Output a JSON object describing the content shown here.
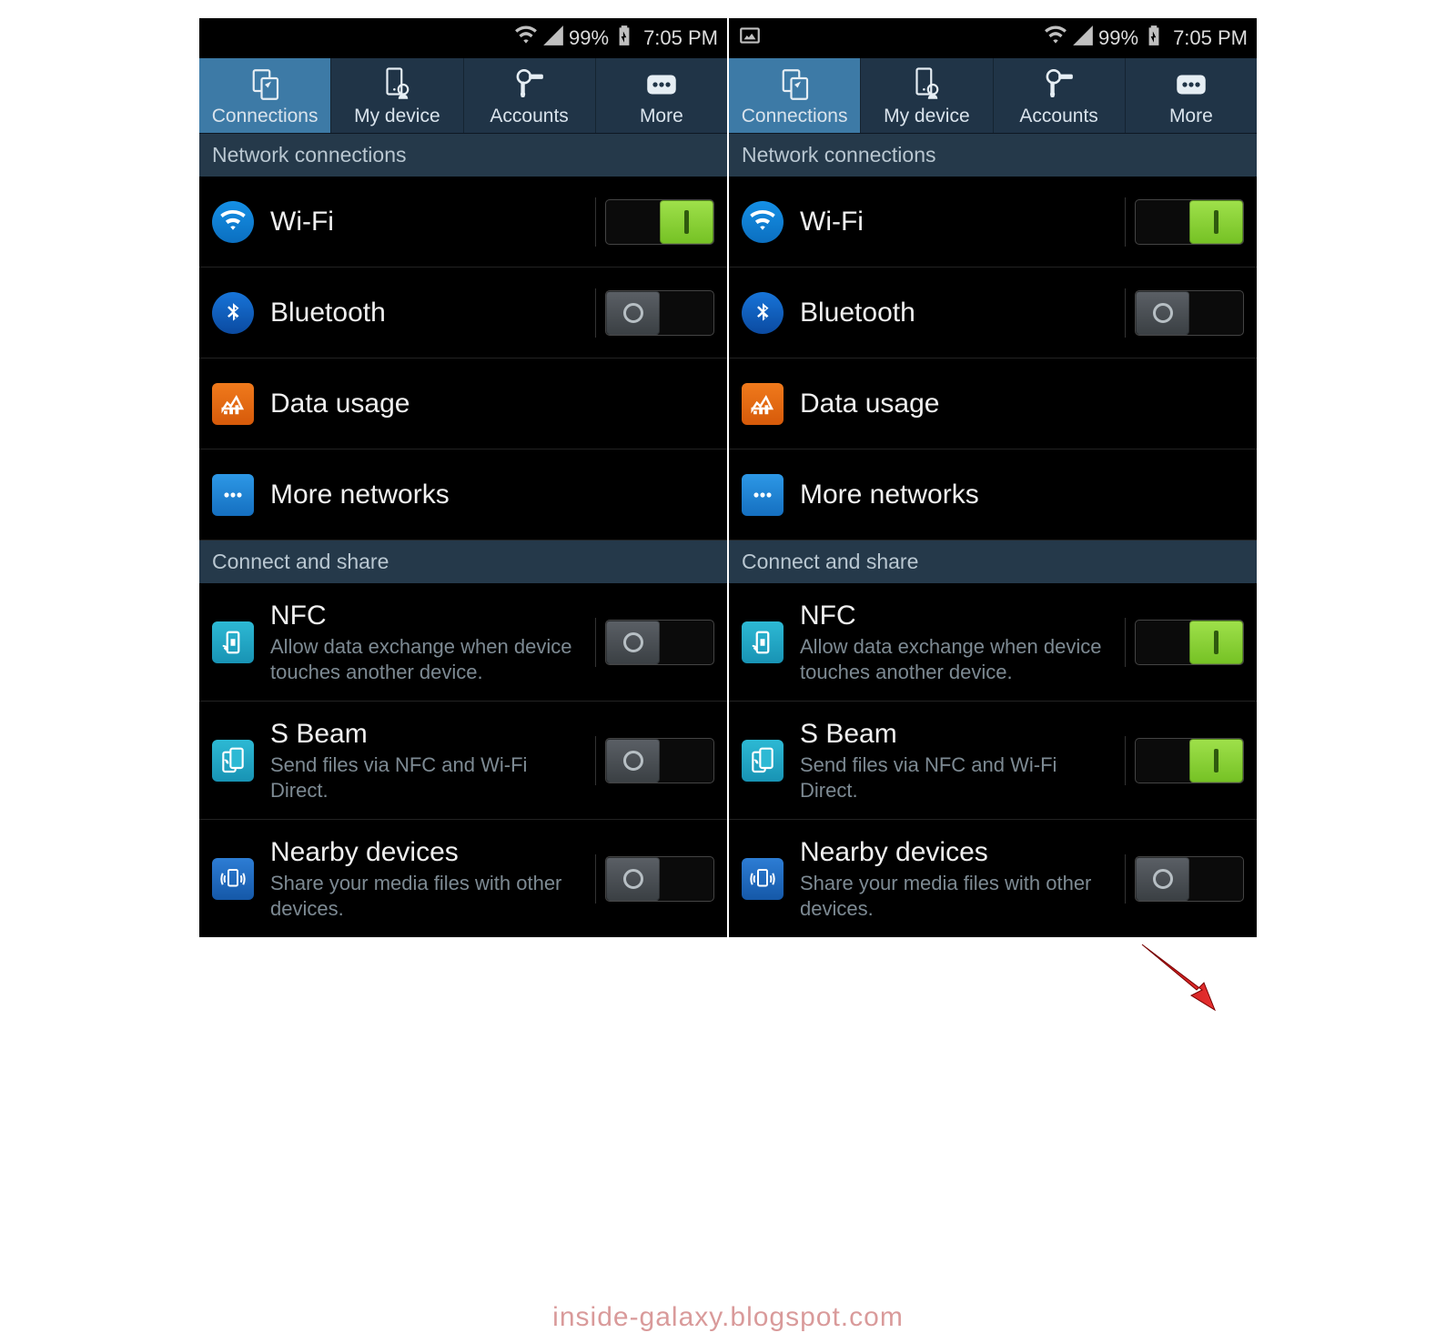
{
  "status": {
    "battery": "99%",
    "time": "7:05 PM"
  },
  "tabs": [
    {
      "label": "Connections"
    },
    {
      "label": "My device"
    },
    {
      "label": "Accounts"
    },
    {
      "label": "More"
    }
  ],
  "sections": {
    "network_header": "Network connections",
    "connect_header": "Connect and share"
  },
  "rows": {
    "wifi": {
      "title": "Wi-Fi"
    },
    "bluetooth": {
      "title": "Bluetooth"
    },
    "data_usage": {
      "title": "Data usage"
    },
    "more_networks": {
      "title": "More networks"
    },
    "nfc": {
      "title": "NFC",
      "subtitle": "Allow data exchange when device touches another device."
    },
    "sbeam": {
      "title": "S Beam",
      "subtitle": "Send files via NFC and Wi-Fi Direct."
    },
    "nearby": {
      "title": "Nearby devices",
      "subtitle": "Share your media files with other devices."
    }
  },
  "screens": [
    {
      "has_picture_icon": false,
      "nfc_on": false,
      "sbeam_on": false
    },
    {
      "has_picture_icon": true,
      "nfc_on": true,
      "sbeam_on": true,
      "arrow_to_sbeam": true
    }
  ],
  "watermark": "inside-galaxy.blogspot.com"
}
